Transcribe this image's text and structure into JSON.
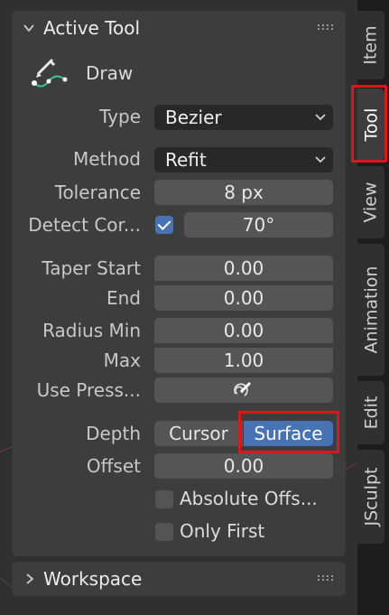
{
  "side_tabs": [
    {
      "label": "Item"
    },
    {
      "label": "Tool"
    },
    {
      "label": "View"
    },
    {
      "label": "Animation"
    },
    {
      "label": "Edit"
    },
    {
      "label": "JSculpt"
    }
  ],
  "active_tool": {
    "header": "Active Tool",
    "tool_name": "Draw",
    "type_label": "Type",
    "type_value": "Bezier",
    "method_label": "Method",
    "method_value": "Refit",
    "tolerance_label": "Tolerance",
    "tolerance_value": "8 px",
    "detect_corners_label": "Detect Cor...",
    "detect_corners_checked": true,
    "detect_corners_value": "70°",
    "taper_start_label": "Taper Start",
    "taper_start_value": "0.00",
    "taper_end_label": "End",
    "taper_end_value": "0.00",
    "radius_min_label": "Radius Min",
    "radius_min_value": "0.00",
    "radius_max_label": "Max",
    "radius_max_value": "1.00",
    "use_pressure_label": "Use Press...",
    "depth_label": "Depth",
    "depth_cursor": "Cursor",
    "depth_surface": "Surface",
    "offset_label": "Offset",
    "offset_value": "0.00",
    "absolute_offset_label": "Absolute Offs...",
    "only_first_label": "Only First"
  },
  "workspace": {
    "header": "Workspace"
  },
  "colors": {
    "accent": "#4772b3",
    "highlight": "#e0141b"
  }
}
